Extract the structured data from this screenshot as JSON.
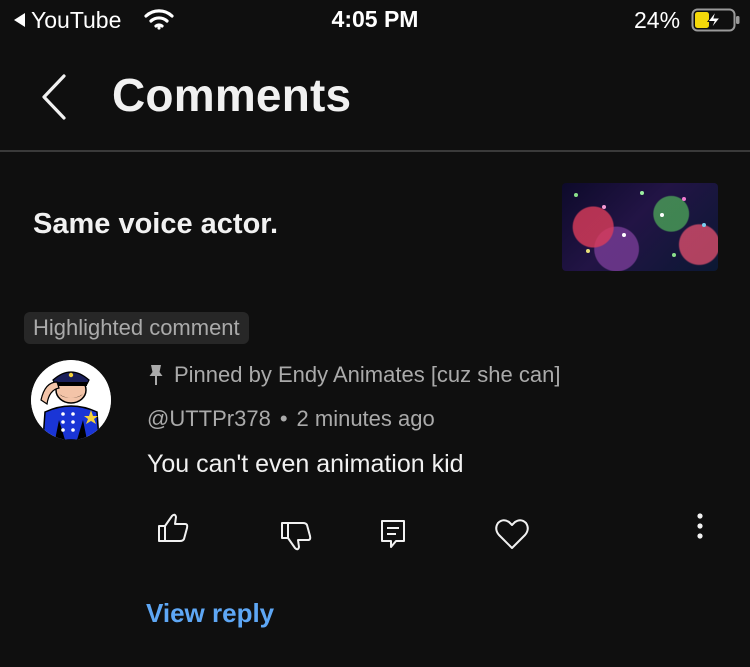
{
  "status_bar": {
    "back_app_label": "YouTube",
    "time": "4:05 PM",
    "battery_percent": "24%",
    "battery_level": 0.24,
    "charging": true
  },
  "header": {
    "title": "Comments"
  },
  "video": {
    "title": "Same voice actor."
  },
  "comment": {
    "badge": "Highlighted comment",
    "pinned_text": "Pinned by Endy Animates [cuz she can]",
    "author": "@UTTPr378",
    "time_ago": "2 minutes ago",
    "text": "You can't even animation kid",
    "view_reply_label": "View reply"
  },
  "icons": {
    "back_app": "back-triangle-icon",
    "wifi": "wifi-icon",
    "battery": "battery-charging-icon",
    "back": "chevron-left-icon",
    "pin": "pin-icon",
    "like": "thumbs-up-icon",
    "dislike": "thumbs-down-icon",
    "reply": "reply-comment-icon",
    "heart": "heart-icon",
    "more": "more-vertical-icon"
  },
  "colors": {
    "background": "#0f0f0f",
    "accent_link": "#5ea7f5",
    "battery_fill": "#f5d90a",
    "secondary_text": "#aaaaaa"
  }
}
